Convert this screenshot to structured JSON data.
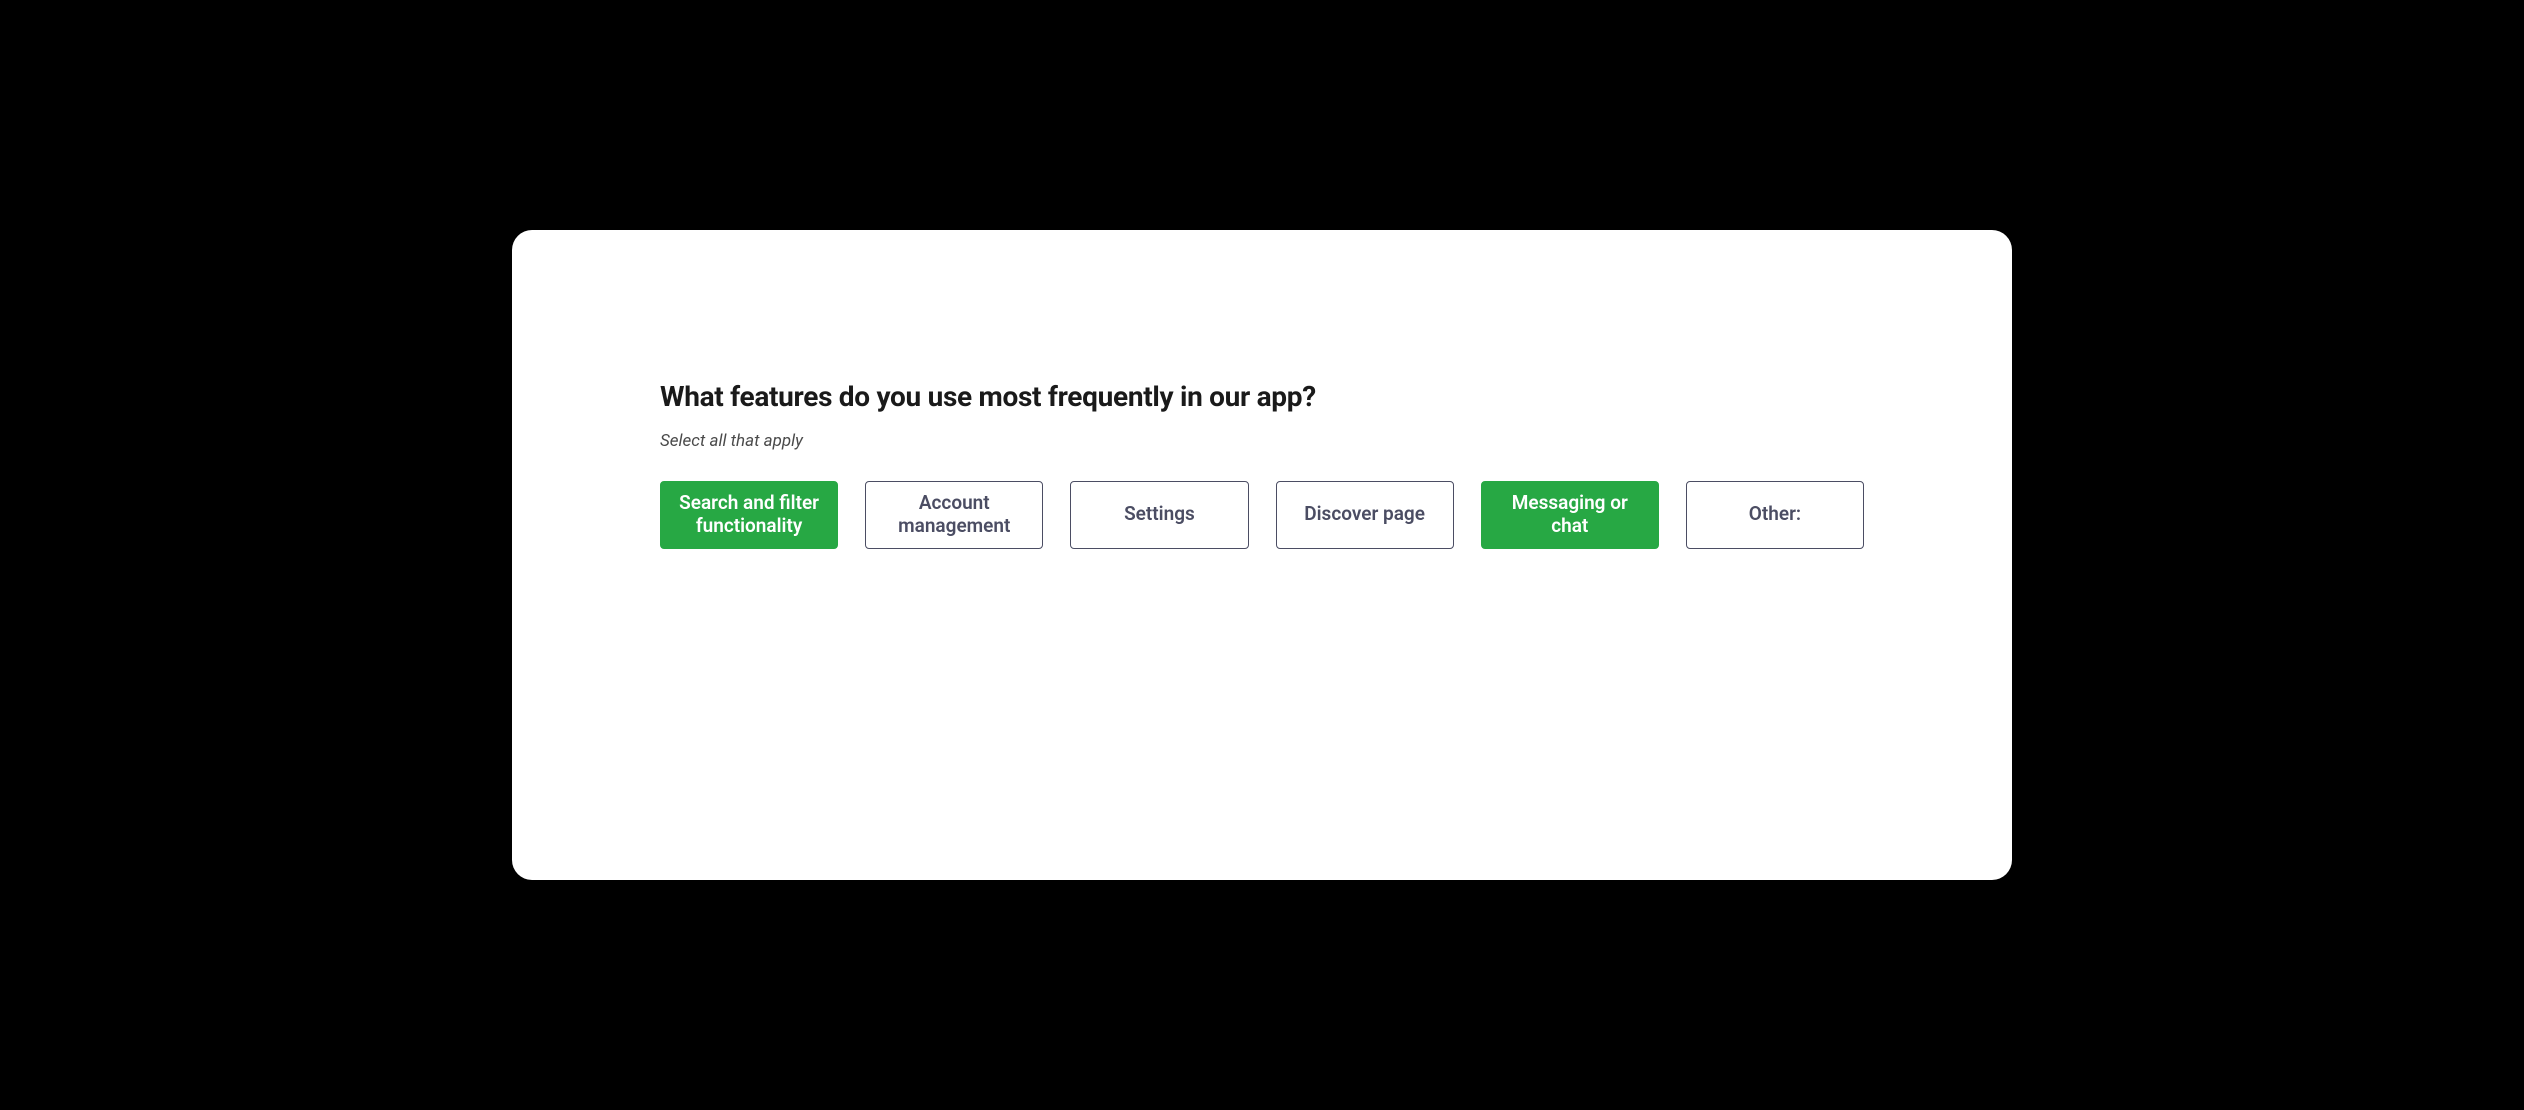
{
  "question": {
    "title": "What features do you use most frequently in our app?",
    "subtitle": "Select all that apply",
    "options": [
      {
        "label": "Search and filter functionality",
        "selected": true
      },
      {
        "label": "Account management",
        "selected": false
      },
      {
        "label": "Settings",
        "selected": false
      },
      {
        "label": "Discover page",
        "selected": false
      },
      {
        "label": "Messaging or chat",
        "selected": true
      },
      {
        "label": "Other:",
        "selected": false
      }
    ]
  },
  "colors": {
    "selected_bg": "#27a844",
    "unselected_border": "#4b4d63",
    "unselected_text": "#4b4d63"
  }
}
